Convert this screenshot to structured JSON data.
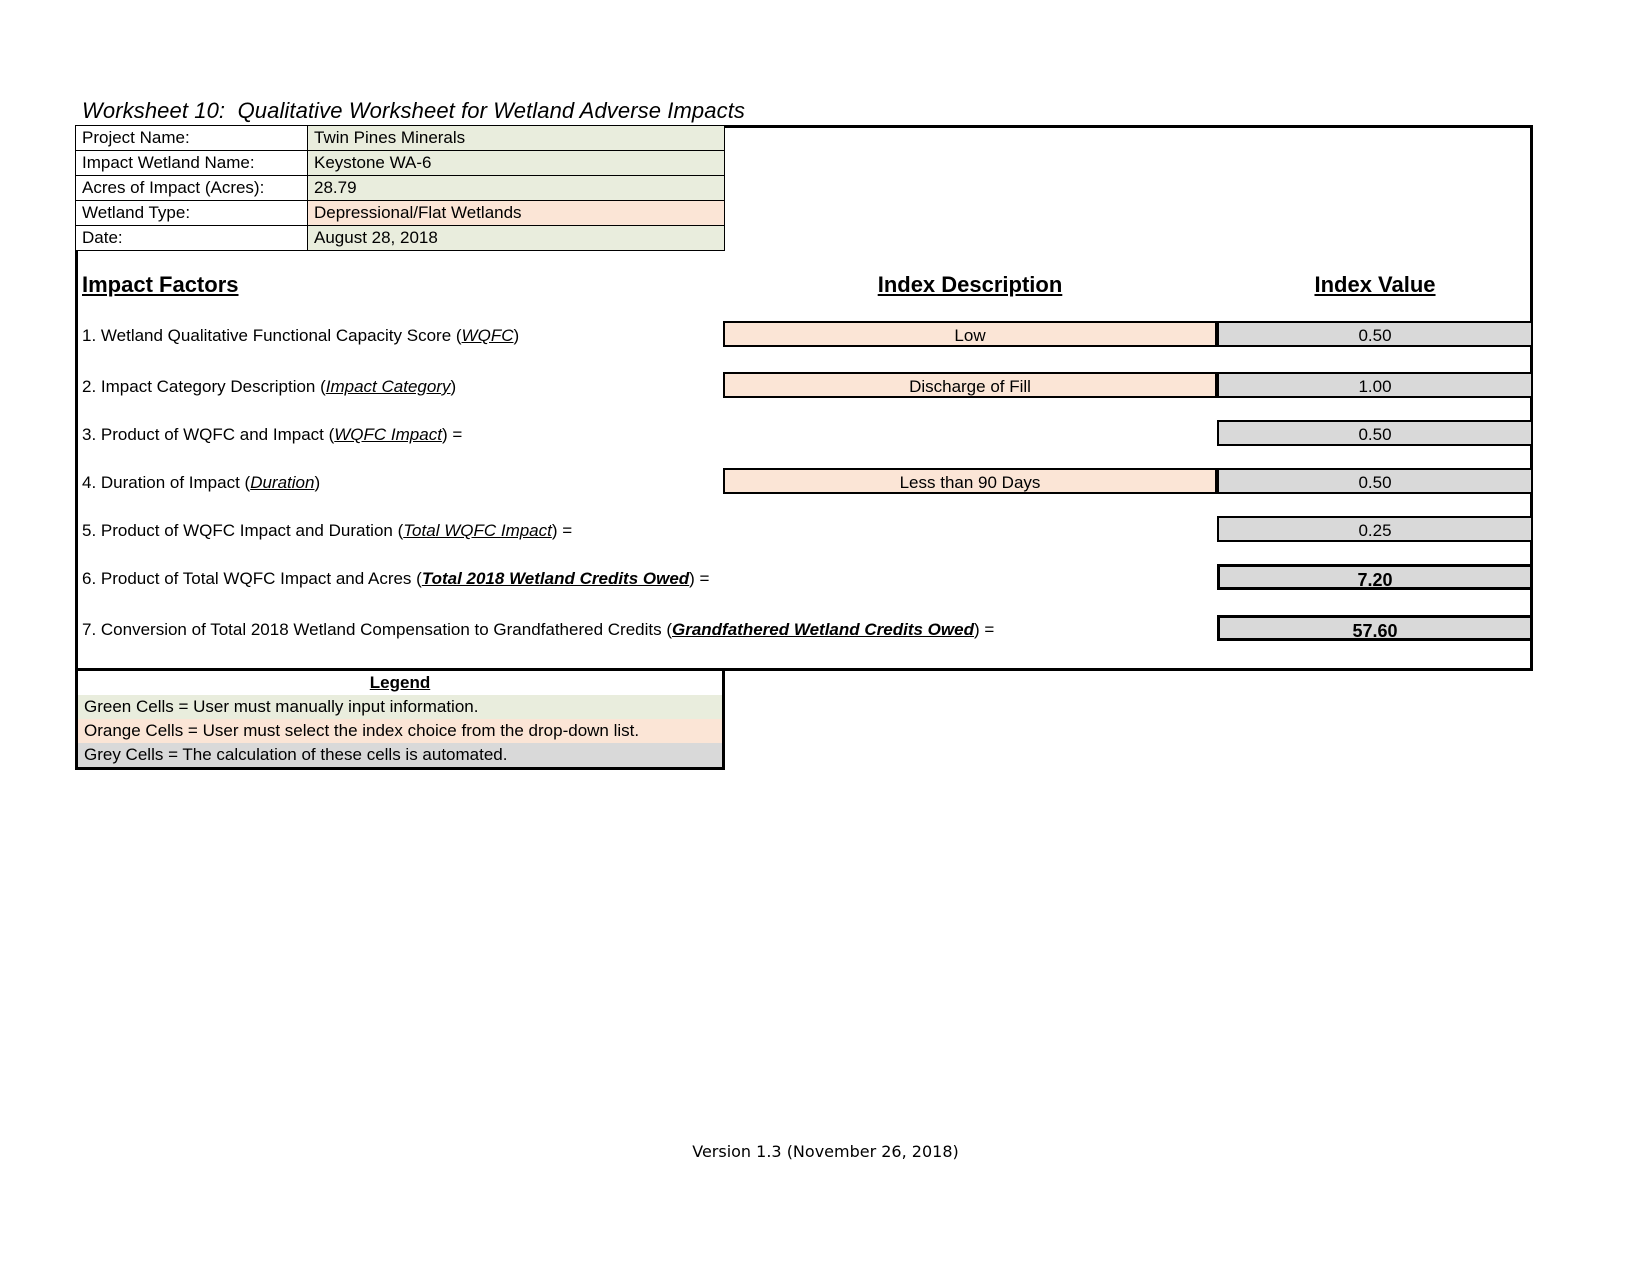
{
  "title": "Worksheet 10:  Qualitative Worksheet for Wetland Adverse Impacts",
  "info": {
    "rows": [
      {
        "label": "Project Name:",
        "value": "Twin Pines Minerals",
        "fill": "green"
      },
      {
        "label": "Impact Wetland Name:",
        "value": "Keystone WA-6",
        "fill": "green"
      },
      {
        "label": "Acres of Impact (Acres):",
        "value": "28.79",
        "fill": "green"
      },
      {
        "label": "Wetland Type:",
        "value": "Depressional/Flat Wetlands",
        "fill": "orange"
      },
      {
        "label": "Date:",
        "value": "August 28, 2018",
        "fill": "green"
      }
    ]
  },
  "columns": {
    "impact_factors": "Impact Factors",
    "index_description": "Index Description",
    "index_value": "Index Value"
  },
  "factors": [
    {
      "number": "1.",
      "text_before": "1. Wetland Qualitative Functional Capacity Score (",
      "term": "WQFC",
      "text_after": ")",
      "description": "Low",
      "value": "0.50"
    },
    {
      "number": "2.",
      "text_before": "2. Impact Category Description (",
      "term": "Impact Category",
      "text_after": ")",
      "description": "Discharge of Fill",
      "value": "1.00"
    },
    {
      "number": "3.",
      "text_before": "3. Product of WQFC and Impact (",
      "term": "WQFC Impact",
      "text_after": ") =",
      "description": "",
      "value": "0.50"
    },
    {
      "number": "4.",
      "text_before": "4. Duration of Impact (",
      "term": "Duration",
      "text_after": ")",
      "description": "Less than 90 Days",
      "value": "0.50"
    },
    {
      "number": "5.",
      "text_before": "5. Product of WQFC Impact and Duration (",
      "term": "Total WQFC Impact",
      "text_after": ") =",
      "description": "",
      "value": "0.25"
    },
    {
      "number": "6.",
      "text_before": "6. Product of Total WQFC Impact and Acres (",
      "term": "Total 2018 Wetland Credits Owed",
      "text_after": ") =",
      "description": "",
      "value": "7.20"
    },
    {
      "number": "7.",
      "text_before": "7. Conversion of Total 2018 Wetland Compensation to Grandfathered Credits (",
      "term": "Grandfathered Wetland Credits Owed",
      "text_after": ") =",
      "description": "",
      "value": "57.60"
    }
  ],
  "legend": {
    "title": "Legend",
    "items": [
      {
        "text": "Green Cells = User must manually input information.",
        "fill": "green"
      },
      {
        "text": "Orange Cells = User must select the index choice from the drop-down list.",
        "fill": "orange"
      },
      {
        "text": "Grey Cells = The calculation of these cells is automated.",
        "fill": "grey"
      }
    ]
  },
  "footer": {
    "version": "Version 1.3 (November 26, 2018)"
  },
  "colors": {
    "green_cell": "#e9eddd",
    "orange_cell": "#fbe5d6",
    "grey_cell": "#d9d9d9",
    "border": "#000000"
  }
}
